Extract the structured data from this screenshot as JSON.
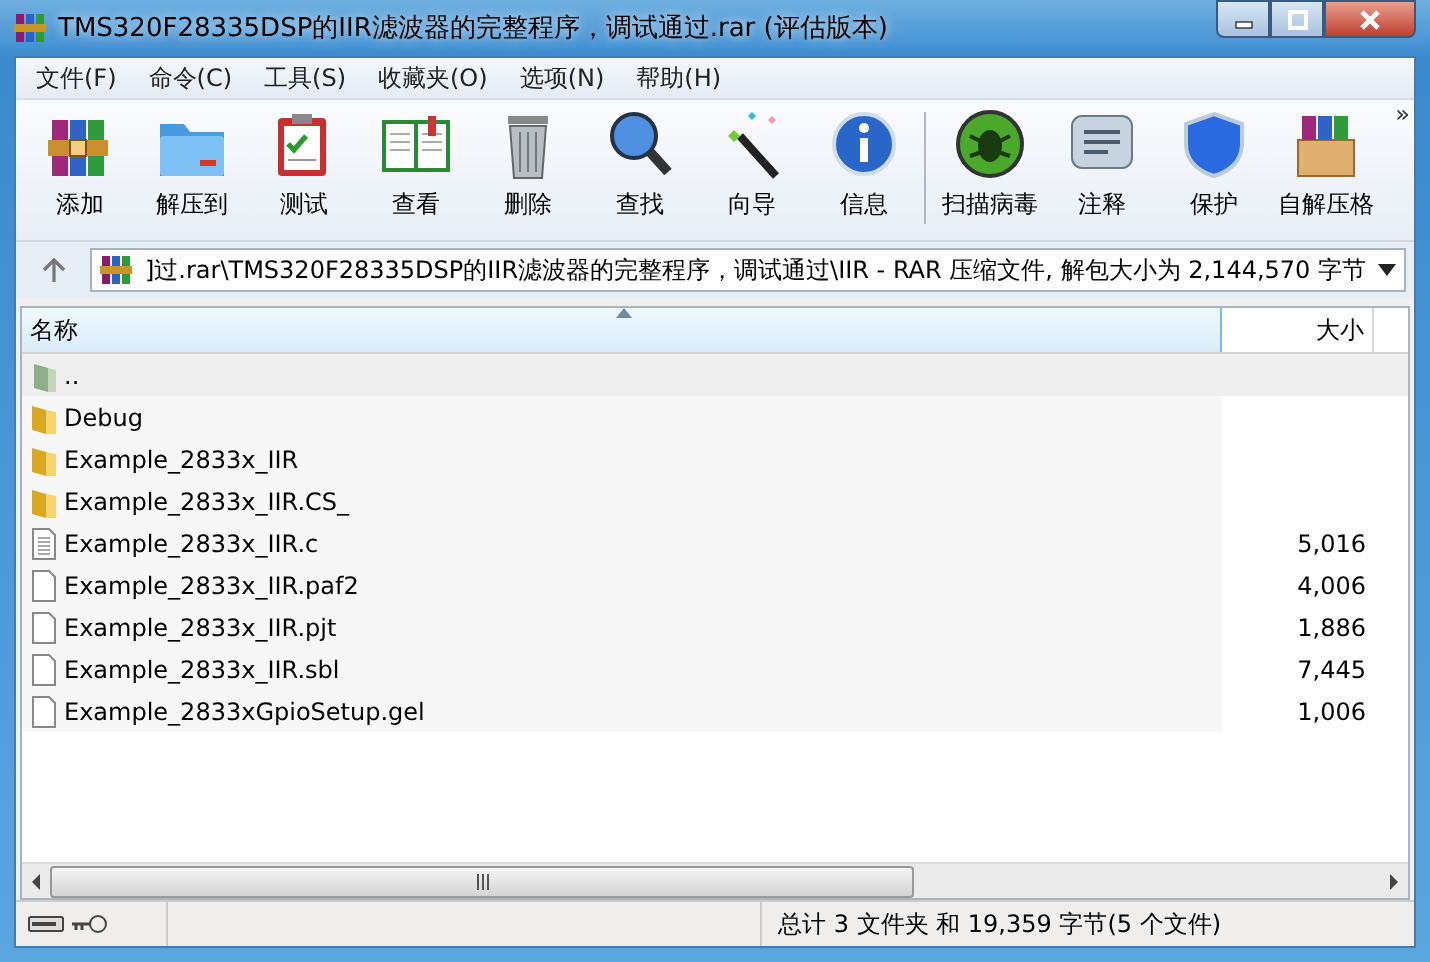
{
  "window": {
    "title": "TMS320F28335DSP的IIR滤波器的完整程序，调试通过.rar (评估版本)"
  },
  "menu": [
    "文件(F)",
    "命令(C)",
    "工具(S)",
    "收藏夹(O)",
    "选项(N)",
    "帮助(H)"
  ],
  "toolbar": [
    "添加",
    "解压到",
    "测试",
    "查看",
    "删除",
    "查找",
    "向导",
    "信息",
    "扫描病毒",
    "注释",
    "保护",
    "自解压格"
  ],
  "toolbar_more": "»",
  "address": {
    "path": "]过.rar\\TMS320F28335DSP的IIR滤波器的完整程序，调试通过\\IIR - RAR 压缩文件, 解包大小为 2,144,570 字节"
  },
  "table": {
    "columns": [
      "名称",
      "大小"
    ],
    "rows": [
      {
        "kind": "up",
        "name": "..",
        "size": "",
        "selected": true
      },
      {
        "kind": "folder",
        "name": "Debug",
        "size": "",
        "selected": false
      },
      {
        "kind": "folder",
        "name": "Example_2833x_IIR",
        "size": "",
        "selected": false
      },
      {
        "kind": "folder",
        "name": "Example_2833x_IIR.CS_",
        "size": "",
        "selected": false
      },
      {
        "kind": "text",
        "name": "Example_2833x_IIR.c",
        "size": "5,016",
        "selected": false
      },
      {
        "kind": "file",
        "name": "Example_2833x_IIR.paf2",
        "size": "4,006",
        "selected": false
      },
      {
        "kind": "file",
        "name": "Example_2833x_IIR.pjt",
        "size": "1,886",
        "selected": false
      },
      {
        "kind": "file",
        "name": "Example_2833x_IIR.sbl",
        "size": "7,445",
        "selected": false
      },
      {
        "kind": "file",
        "name": "Example_2833xGpioSetup.gel",
        "size": "1,006",
        "selected": false
      }
    ]
  },
  "status_bar": {
    "text": "总计 3 文件夹 和 19,359 字节(5 个文件)"
  }
}
